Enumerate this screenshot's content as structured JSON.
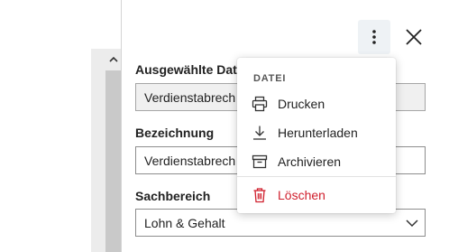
{
  "form": {
    "fields": [
      {
        "label": "Ausgewählte Date",
        "value": "Verdienstabrech"
      },
      {
        "label": "Bezeichnung",
        "value": "Verdienstabrech"
      },
      {
        "label": "Sachbereich",
        "value": "Lohn & Gehalt"
      }
    ]
  },
  "menu": {
    "header": "DATEI",
    "items": [
      {
        "label": "Drucken",
        "icon": "printer-icon"
      },
      {
        "label": "Herunterladen",
        "icon": "download-icon"
      },
      {
        "label": "Archivieren",
        "icon": "archive-icon"
      },
      {
        "label": "Löschen",
        "icon": "trash-icon"
      }
    ]
  },
  "colors": {
    "danger": "#d0202e",
    "accent_bg": "#eef2f5"
  }
}
